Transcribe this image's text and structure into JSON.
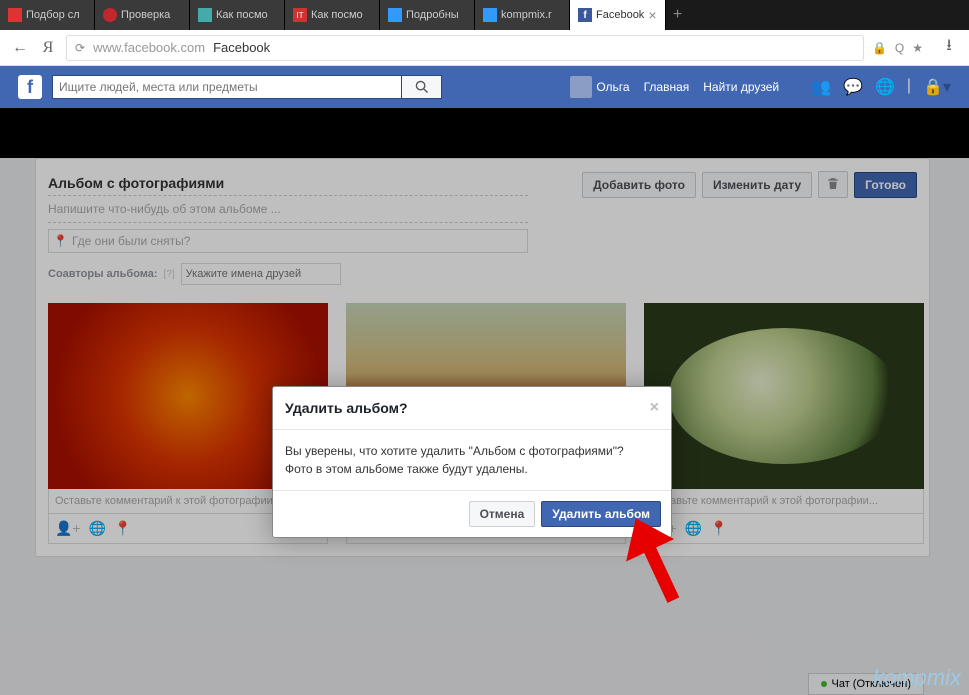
{
  "browser": {
    "tabs": [
      {
        "label": "Подбор сл",
        "active": false,
        "icon_color": "#d33"
      },
      {
        "label": "Проверка",
        "active": false,
        "icon_color": "#c1272d"
      },
      {
        "label": "Как посмо",
        "active": false,
        "icon_color": "#4aa"
      },
      {
        "label": "Как посмо",
        "active": false,
        "icon_color": "#c33"
      },
      {
        "label": "Подробны",
        "active": false,
        "icon_color": "#39f"
      },
      {
        "label": "kompmix.r",
        "active": false,
        "icon_color": "#39f"
      },
      {
        "label": "Facebook",
        "active": true,
        "icon_color": "#3b5998"
      }
    ],
    "url_host": "www.facebook.com",
    "url_title": "Facebook"
  },
  "fb_header": {
    "search_placeholder": "Ищите людей, места или предметы",
    "user_name": "Ольга",
    "nav_home": "Главная",
    "nav_friends": "Найти друзей"
  },
  "album": {
    "title": "Альбом с фотографиями",
    "description_placeholder": "Напишите что-нибудь об этом альбоме ...",
    "location_placeholder": "Где они были сняты?",
    "coauthors_label": "Соавторы альбома:",
    "coauthors_placeholder": "Укажите имена друзей",
    "btn_add_photo": "Добавить фото",
    "btn_change_date": "Изменить дату",
    "btn_ready": "Готово",
    "photo_comment_placeholder": "Оставьте комментарий к этой фотографии..."
  },
  "modal": {
    "title": "Удалить альбом?",
    "body_line1": "Вы уверены, что хотите удалить \"Альбом с фотографиями\"?",
    "body_line2": "Фото в этом альбоме также будут удалены.",
    "btn_cancel": "Отмена",
    "btn_delete": "Удалить альбом"
  },
  "chat": {
    "label": "Чат (Отключен)"
  },
  "watermark": "kompmix"
}
